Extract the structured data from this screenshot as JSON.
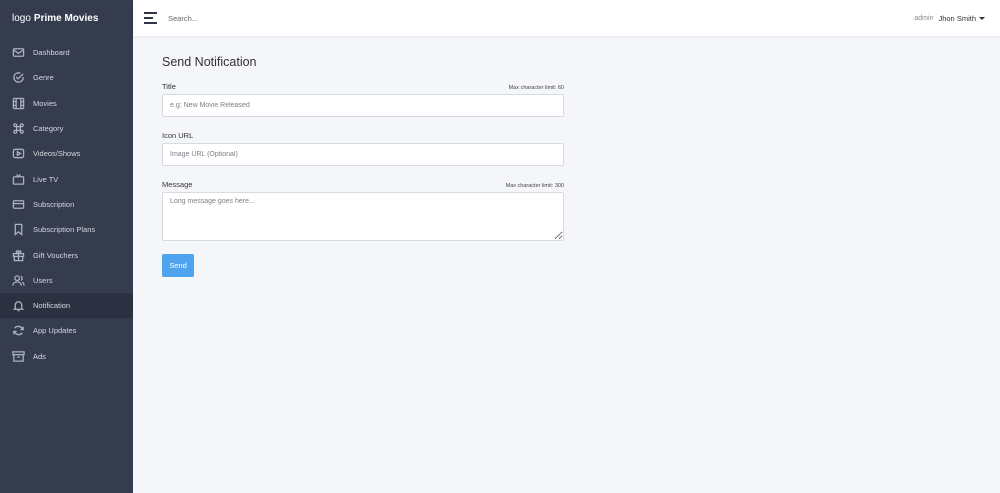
{
  "brand": {
    "logo": "logo",
    "name": "Prime Movies"
  },
  "sidebar": {
    "items": [
      {
        "label": "Dashboard",
        "icon": "envelope-icon"
      },
      {
        "label": "Genre",
        "icon": "check-circle-icon"
      },
      {
        "label": "Movies",
        "icon": "film-icon"
      },
      {
        "label": "Category",
        "icon": "command-icon"
      },
      {
        "label": "Videos/Shows",
        "icon": "play-icon"
      },
      {
        "label": "Live TV",
        "icon": "tv-icon"
      },
      {
        "label": "Subscription",
        "icon": "card-icon"
      },
      {
        "label": "Subscription Plans",
        "icon": "bookmark-icon"
      },
      {
        "label": "Gift Vouchers",
        "icon": "gift-icon"
      },
      {
        "label": "Users",
        "icon": "users-icon"
      },
      {
        "label": "Notification",
        "icon": "bell-icon",
        "active": true
      },
      {
        "label": "App Updates",
        "icon": "refresh-icon"
      },
      {
        "label": "Ads",
        "icon": "archive-icon"
      }
    ]
  },
  "topbar": {
    "search_placeholder": "Search...",
    "role": "admin",
    "username": "Jhon Smith"
  },
  "form": {
    "title": "Send Notification",
    "title_field": {
      "label": "Title",
      "limit": "Max character limit: 60",
      "placeholder": "e.g: New Movie Released",
      "value": ""
    },
    "icon_field": {
      "label": "Icon URL",
      "placeholder": "Image URL (Optional)",
      "value": ""
    },
    "message_field": {
      "label": "Message",
      "limit": "Max character limit: 300",
      "placeholder": "Long message goes here...",
      "value": ""
    },
    "send_label": "Send"
  },
  "colors": {
    "sidebar": "#343c4d",
    "sidebar_active": "#2b3140",
    "accent": "#4ea3ef",
    "background": "#f4f6fa"
  }
}
